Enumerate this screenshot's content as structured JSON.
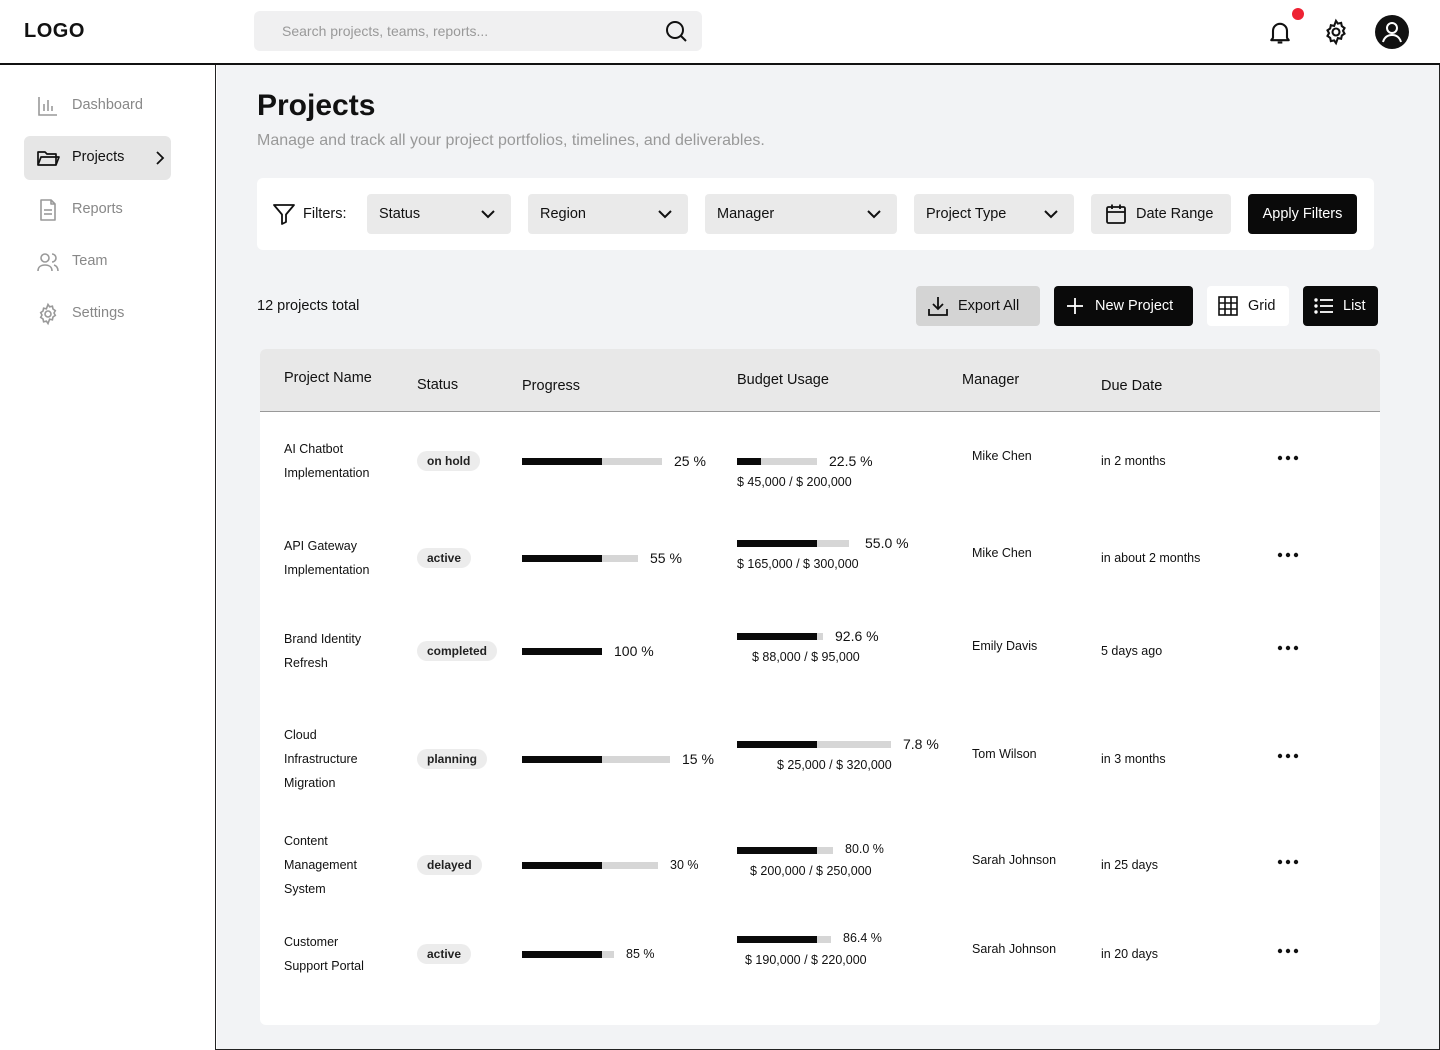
{
  "header": {
    "logo": "LOGO",
    "search_placeholder": "Search projects, teams, reports..."
  },
  "sidebar": {
    "items": [
      {
        "label": "Dashboard",
        "icon": "bar-chart-icon"
      },
      {
        "label": "Projects",
        "icon": "folder-icon",
        "active": true
      },
      {
        "label": "Reports",
        "icon": "file-icon"
      },
      {
        "label": "Team",
        "icon": "users-icon"
      },
      {
        "label": "Settings",
        "icon": "gear-icon"
      }
    ]
  },
  "page": {
    "title": "Projects",
    "subtitle": "Manage and track all your project portfolios, timelines, and deliverables."
  },
  "filters": {
    "label": "Filters:",
    "status": "Status",
    "region": "Region",
    "manager": "Manager",
    "project_type": "Project Type",
    "date_range": "Date Range",
    "apply": "Apply Filters"
  },
  "toolbar": {
    "total": "12 projects total",
    "export": "Export All",
    "new_project": "New Project",
    "grid": "Grid",
    "list": "List"
  },
  "table": {
    "headers": {
      "name": "Project Name",
      "status": "Status",
      "progress": "Progress",
      "budget": "Budget Usage",
      "manager": "Manager",
      "due": "Due Date"
    },
    "rows": [
      {
        "name_lines": [
          "AI Chatbot",
          "Implementation"
        ],
        "status": "on hold",
        "progress": 25,
        "progress_label": "25 %",
        "budget_pct": 22.5,
        "budget_label": "22.5 %",
        "budget_amount": "$ 45,000 / $ 200,000",
        "manager": "Mike Chen",
        "due": "in 2 months"
      },
      {
        "name_lines": [
          "API Gateway",
          "Implementation"
        ],
        "status": "active",
        "progress": 55,
        "progress_label": "55 %",
        "budget_pct": 55.0,
        "budget_label": "55.0 %",
        "budget_amount": "$ 165,000 / $ 300,000",
        "manager": "Mike Chen",
        "due": "in about 2 months"
      },
      {
        "name_lines": [
          "Brand Identity",
          "Refresh"
        ],
        "status": "completed",
        "progress": 100,
        "progress_label": "100 %",
        "budget_pct": 92.6,
        "budget_label": "92.6 %",
        "budget_amount": "$ 88,000 / $ 95,000",
        "manager": "Emily Davis",
        "due": "5 days ago"
      },
      {
        "name_lines": [
          "Cloud",
          "Infrastructure",
          "Migration"
        ],
        "status": "planning",
        "progress": 15,
        "progress_label": "15 %",
        "budget_pct": 7.8,
        "budget_label": "7.8 %",
        "budget_amount": "$ 25,000 / $ 320,000",
        "manager": "Tom Wilson",
        "due": "in 3 months"
      },
      {
        "name_lines": [
          "Content",
          "Management",
          "System"
        ],
        "status": "delayed",
        "progress": 30,
        "progress_label": "30 %",
        "budget_pct": 80.0,
        "budget_label": "80.0 %",
        "budget_amount": "$ 200,000 / $ 250,000",
        "manager": "Sarah Johnson",
        "due": "in 25 days"
      },
      {
        "name_lines": [
          "Customer",
          "Support Portal"
        ],
        "status": "active",
        "progress": 85,
        "progress_label": "85 %",
        "budget_pct": 86.4,
        "budget_label": "86.4 %",
        "budget_amount": "$ 190,000 / $ 220,000",
        "manager": "Sarah Johnson",
        "due": "in 20 days"
      }
    ]
  },
  "colors": {
    "accent": "#0a0a0a",
    "notification": "#ee2233",
    "background": "#f2f3f5"
  }
}
